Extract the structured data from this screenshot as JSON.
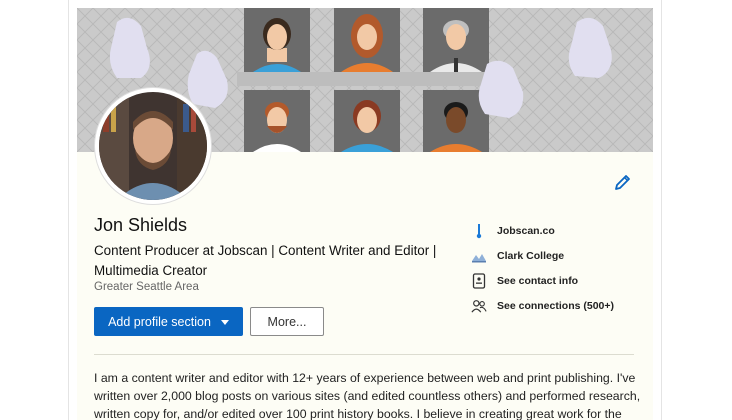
{
  "profile": {
    "name": "Jon Shields",
    "headline": "Content Producer at Jobscan | Content Writer and Editor | Multimedia Creator",
    "location": "Greater Seattle Area"
  },
  "actions": {
    "add_section_label": "Add profile section",
    "more_label": "More..."
  },
  "sidebar_links": [
    {
      "icon": "jobscan-icon",
      "label": "Jobscan.co"
    },
    {
      "icon": "college-icon",
      "label": "Clark College"
    },
    {
      "icon": "contact-card-icon",
      "label": "See contact info"
    },
    {
      "icon": "people-icon",
      "label": "See connections (500+)"
    }
  ],
  "about": {
    "text": "I am a content writer and editor with 12+ years of experience between web and print publishing. I've written over 2,000 blog posts on various sites (and edited countless others) and performed research, written copy for, and/or edited over 100 print history books. I believe in creating great work for the sa..."
  },
  "colors": {
    "primary": "#0a66c2",
    "banner_bg": "#c9c9c9",
    "card_bg": "#fdfdf5"
  }
}
